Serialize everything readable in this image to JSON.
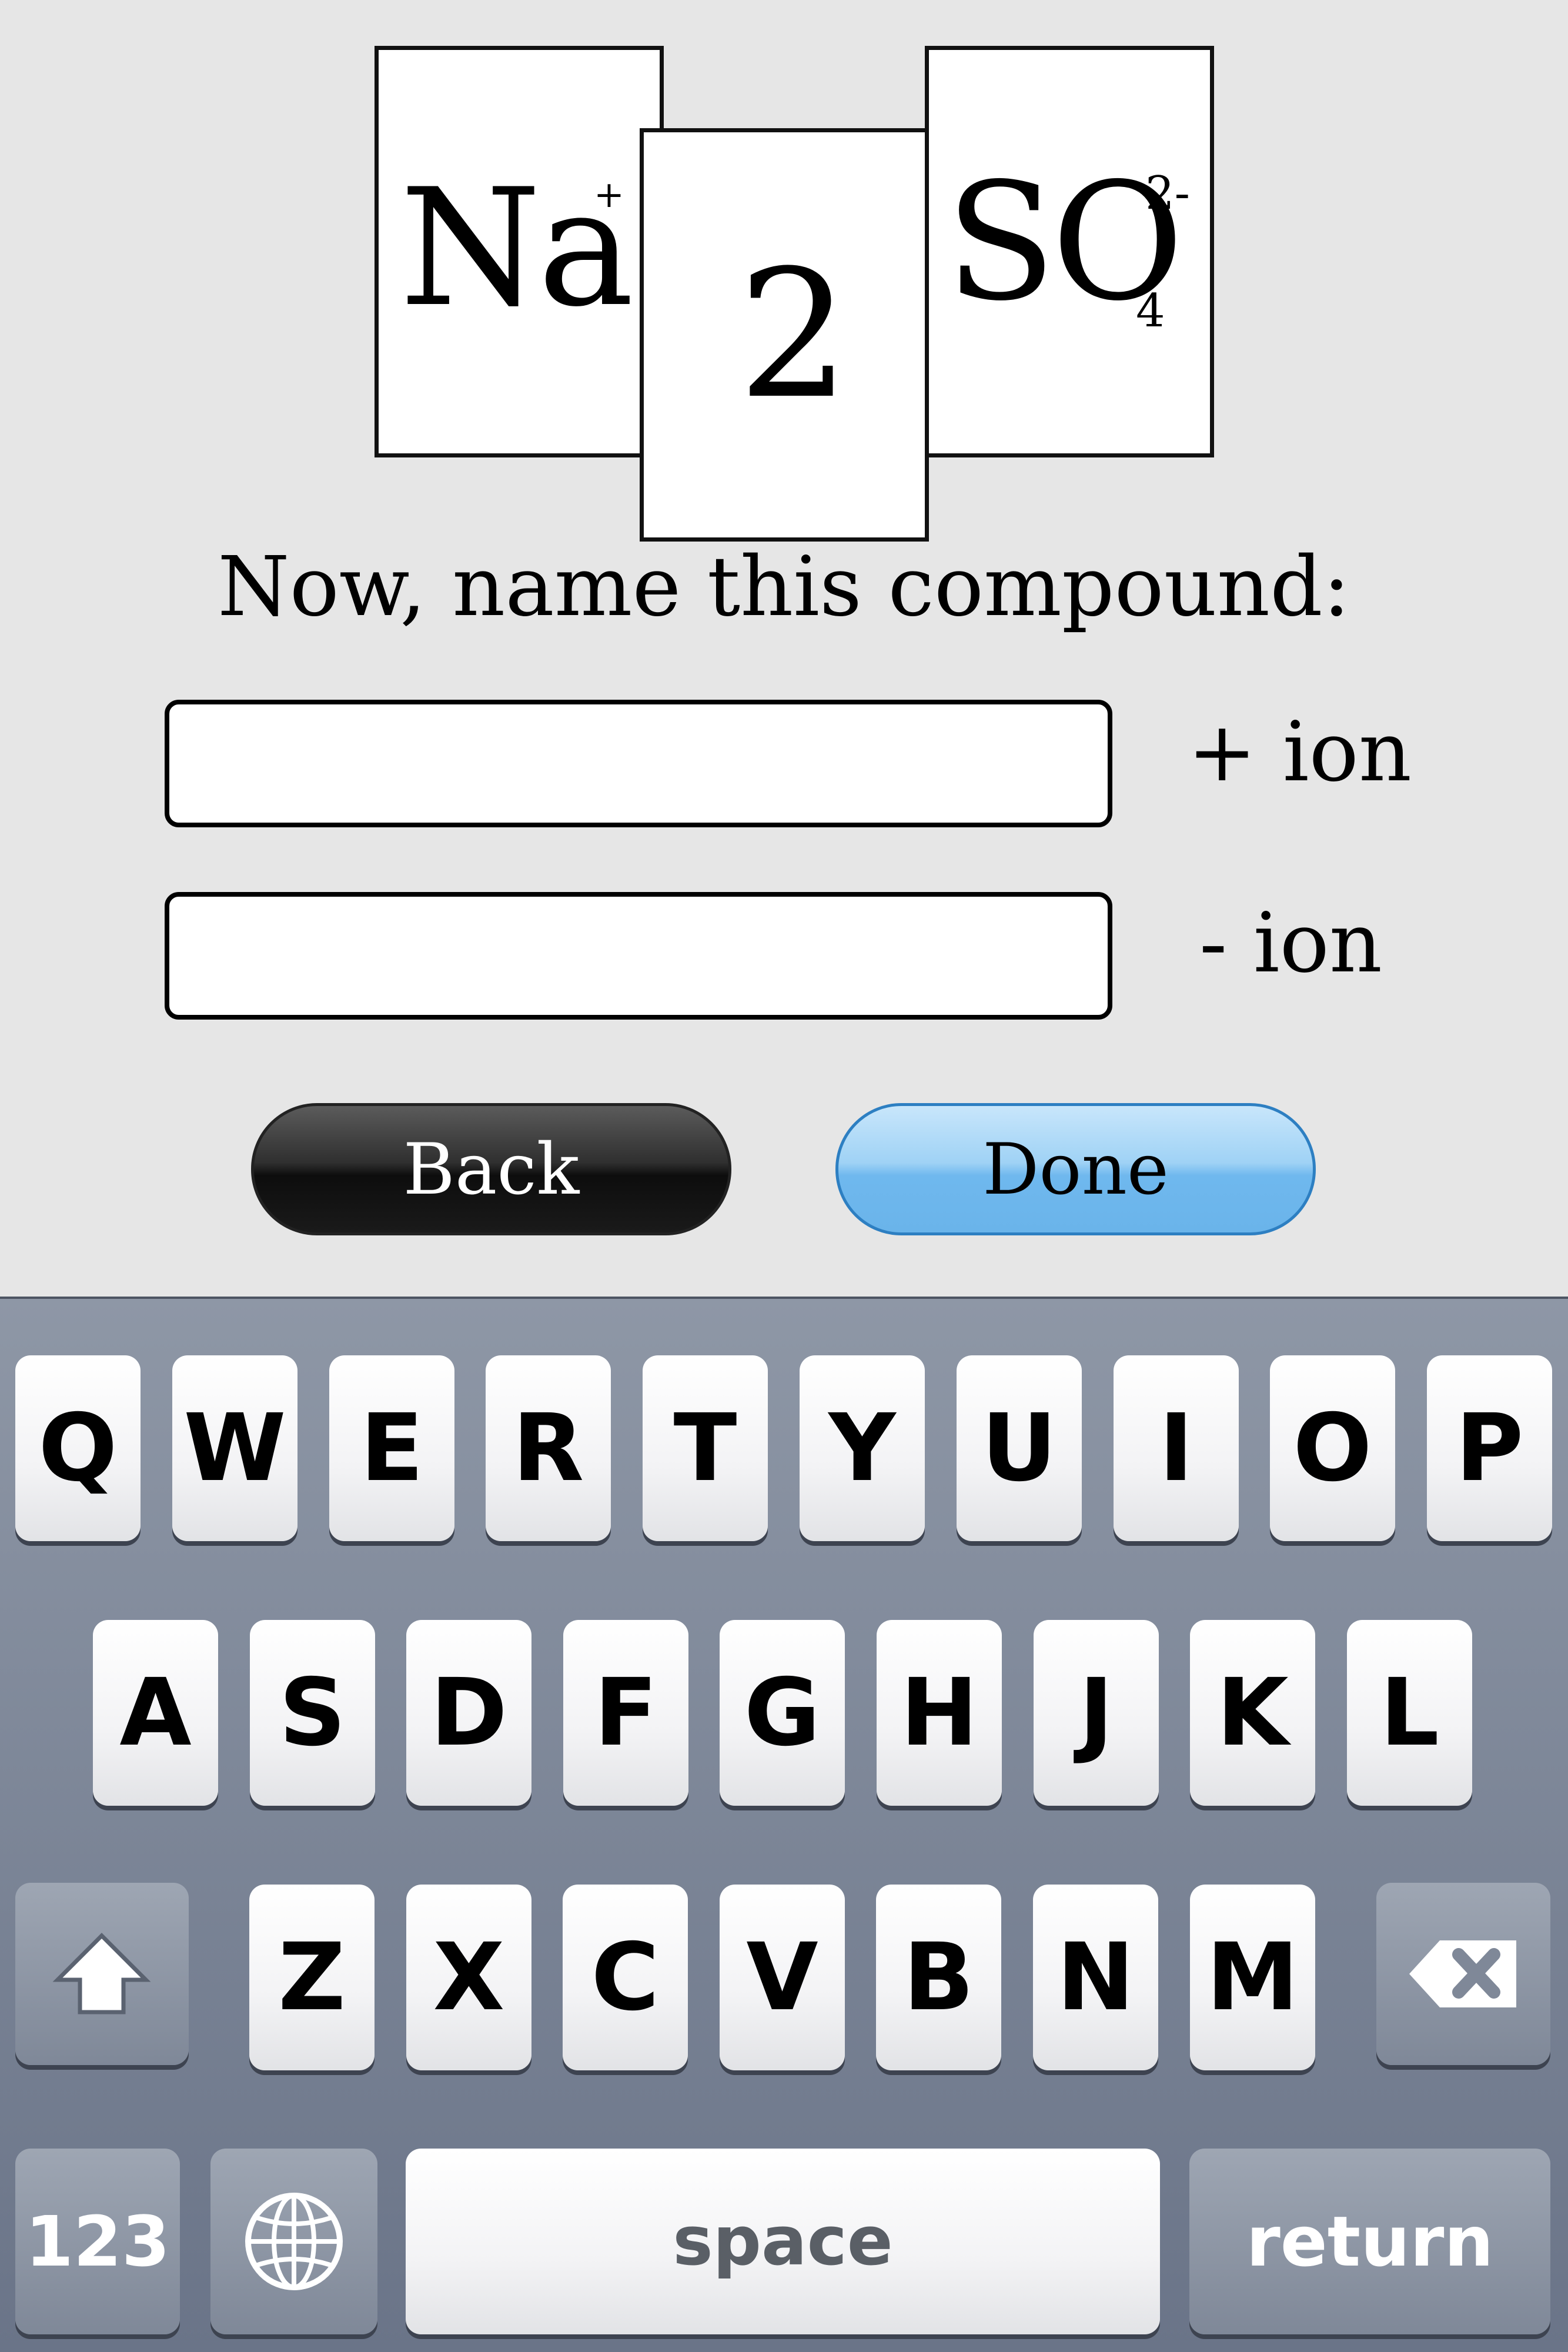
{
  "formula": {
    "cation_symbol": "Na",
    "cation_charge": "+",
    "subscript_card": "2",
    "anion_symbol": "SO",
    "anion_charge": "2-",
    "anion_subscript": "4"
  },
  "prompt": "Now, name this compound:",
  "inputs": {
    "positive_ion": {
      "value": "",
      "label": "+ ion"
    },
    "negative_ion": {
      "value": "",
      "label": "- ion"
    }
  },
  "buttons": {
    "back": "Back",
    "done": "Done"
  },
  "keyboard": {
    "row1": [
      "Q",
      "W",
      "E",
      "R",
      "T",
      "Y",
      "U",
      "I",
      "O",
      "P"
    ],
    "row2": [
      "A",
      "S",
      "D",
      "F",
      "G",
      "H",
      "J",
      "K",
      "L"
    ],
    "row3": [
      "Z",
      "X",
      "C",
      "V",
      "B",
      "N",
      "M"
    ],
    "numbers_key": "123",
    "space_key": "space",
    "return_key": "return",
    "icons": [
      "shift-icon",
      "backspace-icon",
      "globe-icon"
    ]
  }
}
